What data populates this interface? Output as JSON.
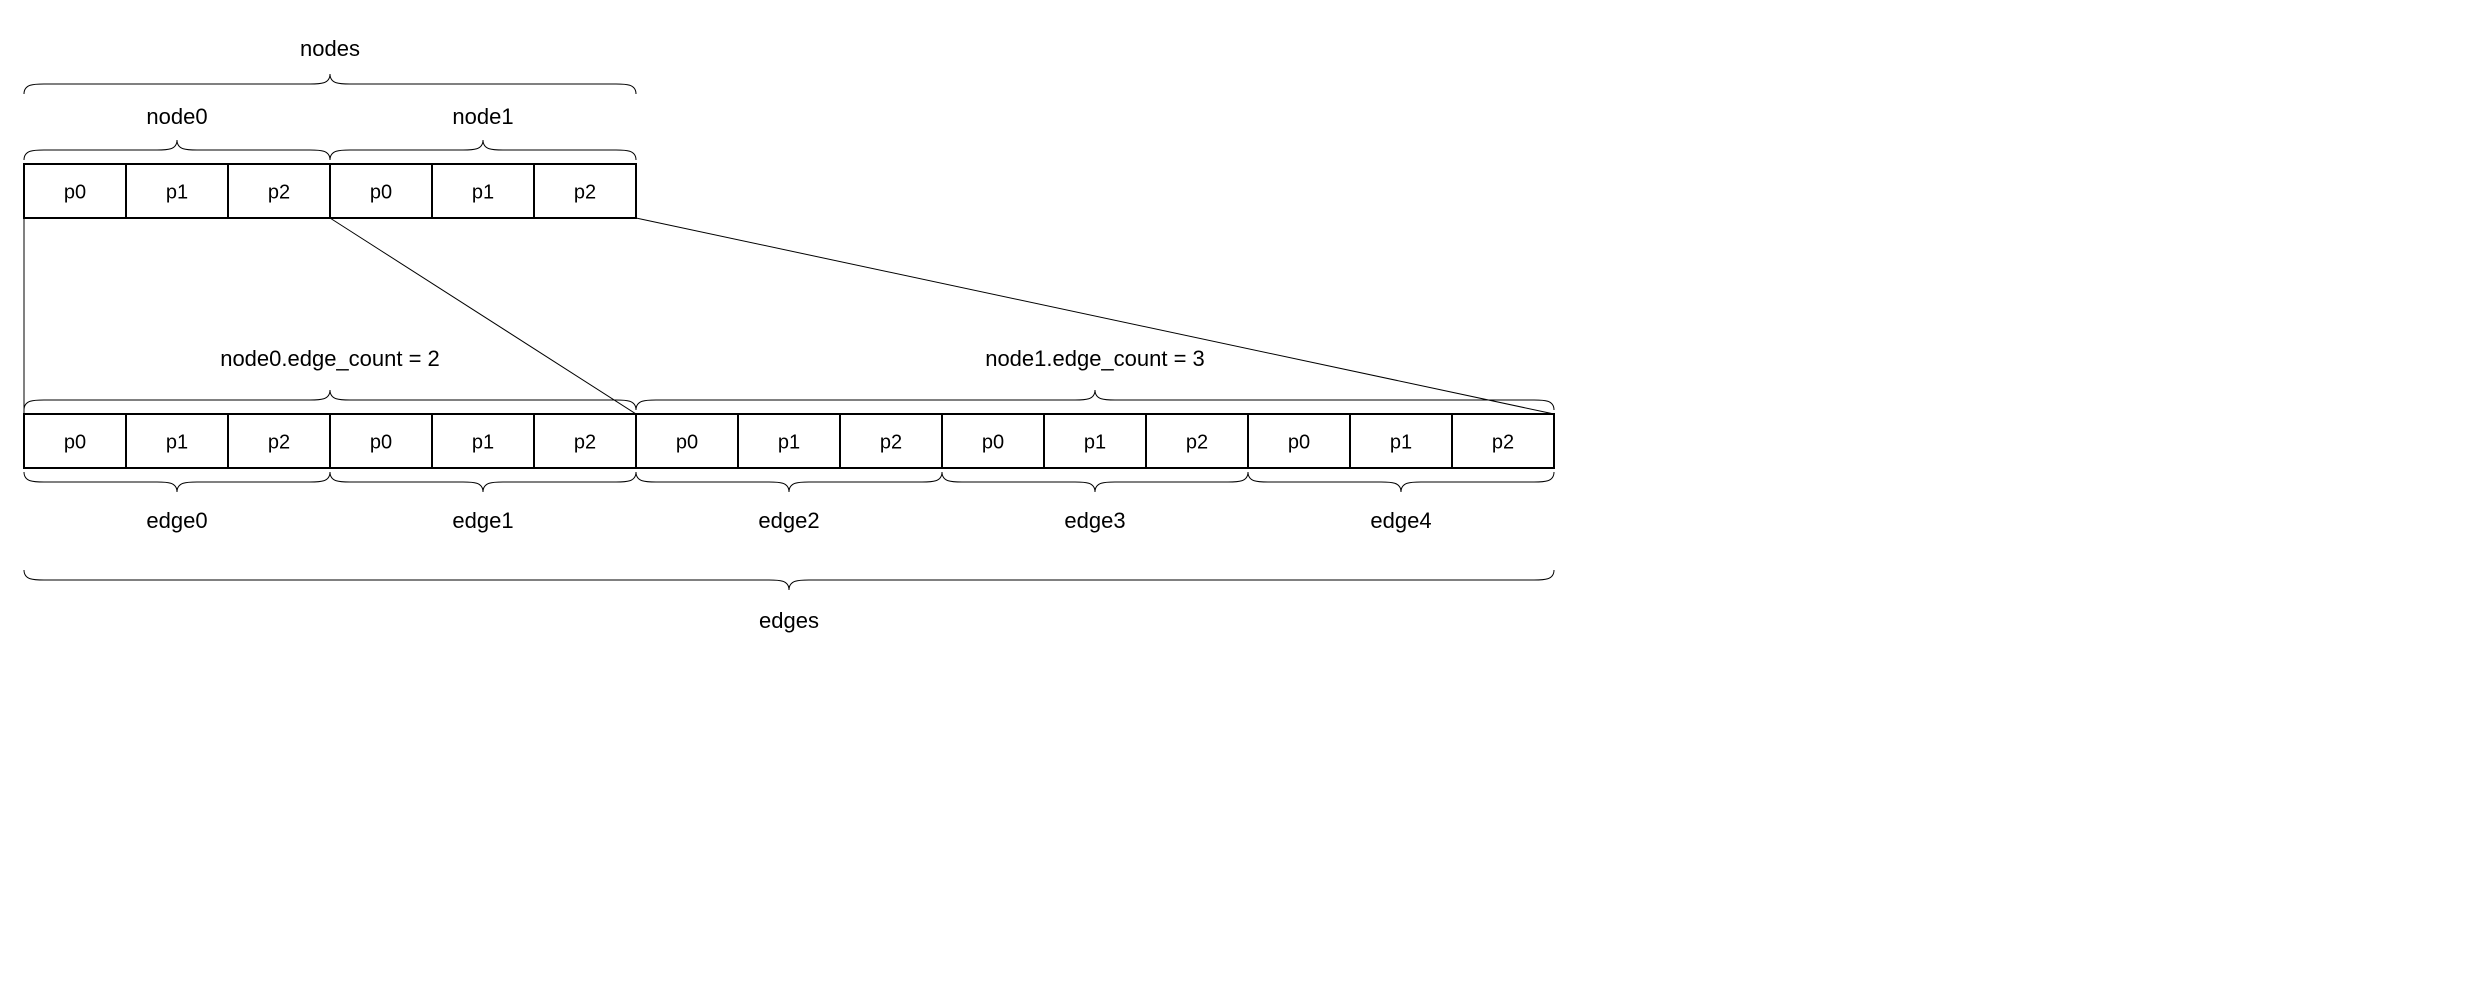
{
  "labels": {
    "nodes": "nodes",
    "node0": "node0",
    "node1": "node1",
    "edge_count0": "node0.edge_count = 2",
    "edge_count1": "node1.edge_count = 3",
    "edge0": "edge0",
    "edge1": "edge1",
    "edge2": "edge2",
    "edge3": "edge3",
    "edge4": "edge4",
    "edges": "edges"
  },
  "top_row": {
    "node0": [
      "p0",
      "p1",
      "p2"
    ],
    "node1": [
      "p0",
      "p1",
      "p2"
    ]
  },
  "bottom_row": {
    "edge0": [
      "p0",
      "p1",
      "p2"
    ],
    "edge1": [
      "p0",
      "p1",
      "p2"
    ],
    "edge2": [
      "p0",
      "p1",
      "p2"
    ],
    "edge3": [
      "p0",
      "p1",
      "p2"
    ],
    "edge4": [
      "p0",
      "p1",
      "p2"
    ]
  },
  "chart_data": {
    "type": "diagram",
    "description": "Memory layout of a graph structure: a contiguous 'nodes' array (node0, node1) each with fields p0,p1,p2, and a contiguous 'edges' array (edge0..edge4) each with fields p0,p1,p2. node0 owns 2 edges (edge0,edge1), node1 owns 3 edges (edge2,edge3,edge4).",
    "nodes": [
      {
        "name": "node0",
        "fields": [
          "p0",
          "p1",
          "p2"
        ],
        "edge_count": 2,
        "edges": [
          "edge0",
          "edge1"
        ]
      },
      {
        "name": "node1",
        "fields": [
          "p0",
          "p1",
          "p2"
        ],
        "edge_count": 3,
        "edges": [
          "edge2",
          "edge3",
          "edge4"
        ]
      }
    ],
    "edges": [
      {
        "name": "edge0",
        "fields": [
          "p0",
          "p1",
          "p2"
        ]
      },
      {
        "name": "edge1",
        "fields": [
          "p0",
          "p1",
          "p2"
        ]
      },
      {
        "name": "edge2",
        "fields": [
          "p0",
          "p1",
          "p2"
        ]
      },
      {
        "name": "edge3",
        "fields": [
          "p0",
          "p1",
          "p2"
        ]
      },
      {
        "name": "edge4",
        "fields": [
          "p0",
          "p1",
          "p2"
        ]
      }
    ]
  }
}
